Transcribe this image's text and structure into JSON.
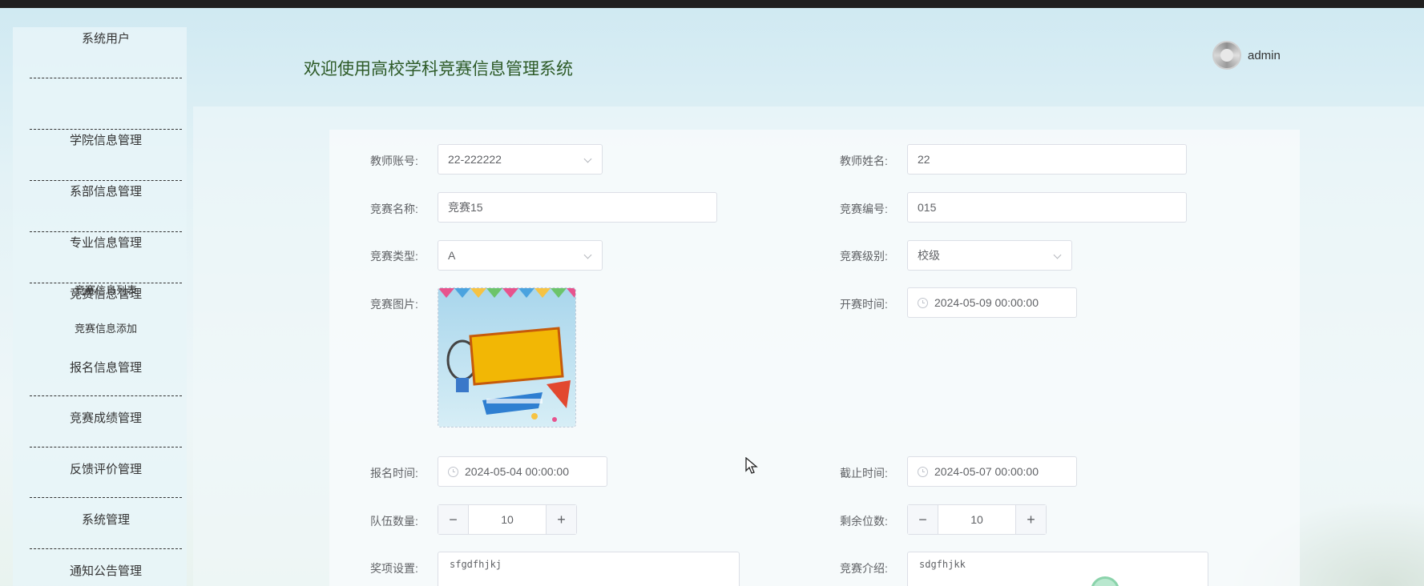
{
  "header": {
    "title": "欢迎使用高校学科竞赛信息管理系统",
    "username": "admin"
  },
  "sidebar": {
    "items": [
      {
        "label": "系统用户"
      },
      {
        "label": "学院信息管理"
      },
      {
        "label": "系部信息管理"
      },
      {
        "label": "专业信息管理"
      },
      {
        "label": "竞赛信息管理"
      },
      {
        "label": "报名信息管理"
      },
      {
        "label": "竞赛成绩管理"
      },
      {
        "label": "反馈评价管理"
      },
      {
        "label": "系统管理"
      },
      {
        "label": "通知公告管理"
      }
    ],
    "subitems": [
      {
        "label": "竞赛信息列表"
      },
      {
        "label": "竞赛信息添加"
      }
    ]
  },
  "form": {
    "teacher_account": {
      "label": "教师账号:",
      "value": "22-222222"
    },
    "teacher_name": {
      "label": "教师姓名:",
      "value": "22"
    },
    "competition_name": {
      "label": "竞赛名称:",
      "value": "竞赛15"
    },
    "competition_code": {
      "label": "竞赛编号:",
      "value": "015"
    },
    "competition_type": {
      "label": "竞赛类型:",
      "value": "A"
    },
    "competition_level": {
      "label": "竞赛级别:",
      "value": "校级"
    },
    "competition_image": {
      "label": "竞赛图片:"
    },
    "start_time": {
      "label": "开赛时间:",
      "value": "2024-05-09 00:00:00"
    },
    "signup_time": {
      "label": "报名时间:",
      "value": "2024-05-04 00:00:00"
    },
    "deadline": {
      "label": "截止时间:",
      "value": "2024-05-07 00:00:00"
    },
    "team_count": {
      "label": "队伍数量:",
      "value": "10"
    },
    "remaining_slots": {
      "label": "剩余位数:",
      "value": "10"
    },
    "award_settings": {
      "label": "奖项设置:",
      "value": "sfgdfhjkj"
    },
    "competition_intro": {
      "label": "竞赛介绍:",
      "value": "sdgfhjkk"
    }
  },
  "icons": {
    "clock": "clock-icon",
    "chevron": "chevron-down-icon",
    "minus": "minus-icon",
    "plus": "plus-icon",
    "avatar": "avatar-icon",
    "cursor": "mouse-pointer-icon"
  },
  "colors": {
    "title": "#2d5a27",
    "border": "#dcdfe6",
    "text": "#606266"
  }
}
